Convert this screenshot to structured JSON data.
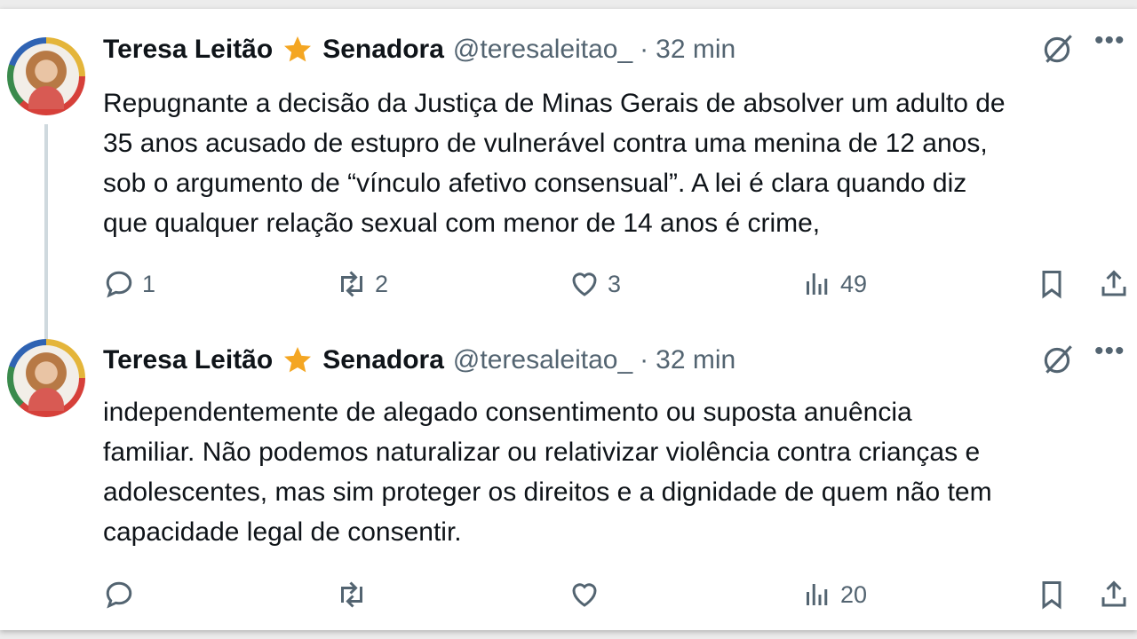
{
  "tweets": [
    {
      "author_name": "Teresa Leitão",
      "author_title": "Senadora",
      "handle": "@teresaleitao_",
      "separator": "·",
      "time": "32 min",
      "text_lines": [
        "Repugnante a decisão da Justiça de Minas Gerais de absolver um adulto de",
        "35 anos acusado de estupro de vulnerável contra uma menina de 12 anos,",
        "sob o argumento de “vínculo afetivo consensual”. A lei é clara quando diz",
        "que qualquer relação sexual com menor de 14 anos é crime,"
      ],
      "replies": "1",
      "reposts": "2",
      "likes": "3",
      "views": "49"
    },
    {
      "author_name": "Teresa Leitão",
      "author_title": "Senadora",
      "handle": "@teresaleitao_",
      "separator": "·",
      "time": "32 min",
      "text_lines": [
        "independentemente de alegado consentimento ou suposta anuência",
        "familiar. Não podemos naturalizar ou relativizar violência contra crianças e",
        "adolescentes, mas sim proteger os direitos e a dignidade de quem não tem",
        "capacidade legal de consentir."
      ],
      "replies": "",
      "reposts": "",
      "likes": "",
      "views": "20"
    }
  ],
  "icons": {
    "star": "star-icon",
    "grok": "grok-icon",
    "more": "more-icon",
    "reply": "reply-icon",
    "repost": "repost-icon",
    "like": "heart-icon",
    "views": "views-icon",
    "bookmark": "bookmark-icon",
    "share": "share-icon"
  },
  "colors": {
    "star": "#f4a622",
    "secondary_text": "#536471",
    "thread_line": "#cfd9de"
  }
}
